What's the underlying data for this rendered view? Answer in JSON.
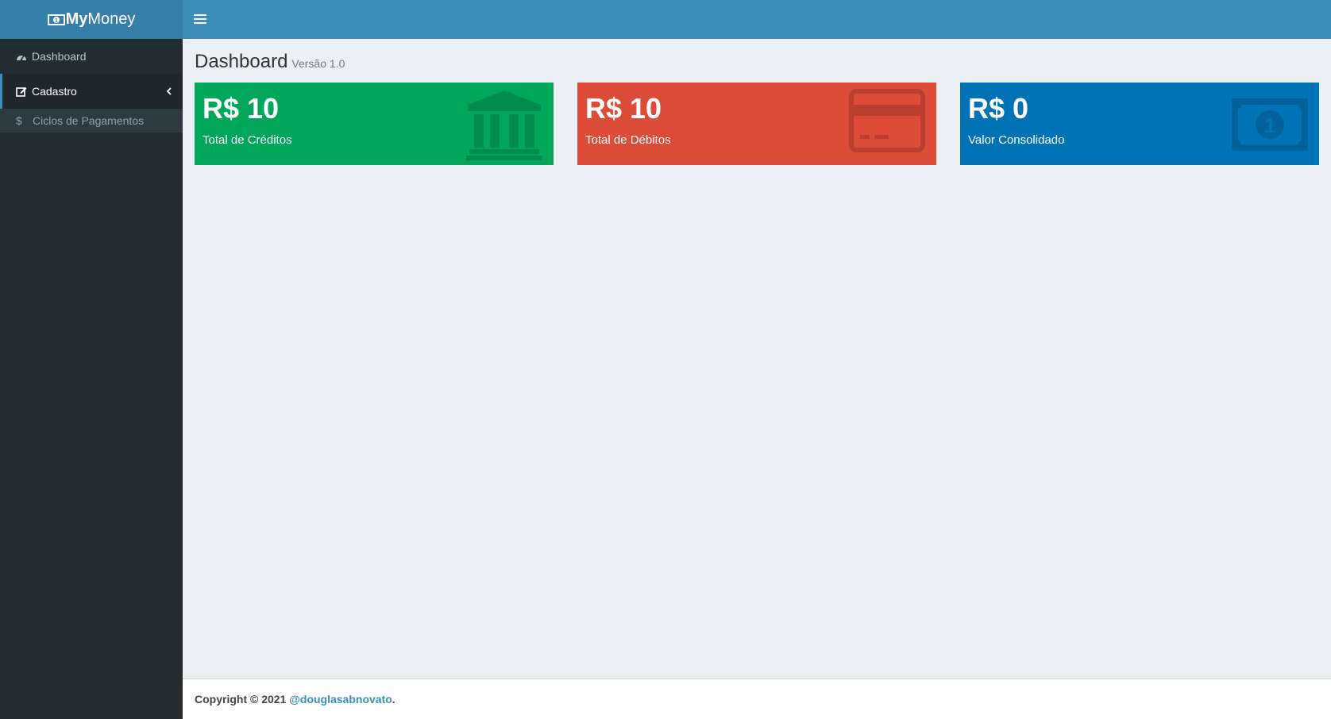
{
  "app": {
    "logo_bold": "My",
    "logo_text": " Money"
  },
  "sidebar": {
    "items": [
      {
        "label": "Dashboard",
        "icon": "dashboard-icon"
      },
      {
        "label": "Cadastro",
        "icon": "edit-icon"
      }
    ],
    "submenu": [
      {
        "label": "Ciclos de Pagamentos",
        "icon": "dollar-icon"
      }
    ]
  },
  "header": {
    "title": "Dashboard",
    "version": "Versão 1.0"
  },
  "boxes": [
    {
      "value": "R$ 10",
      "label": "Total de Créditos",
      "color": "#00a65a",
      "icon": "bank-icon"
    },
    {
      "value": "R$ 10",
      "label": "Total de Débitos",
      "color": "#dd4b39",
      "icon": "credit-card-icon"
    },
    {
      "value": "R$ 0",
      "label": "Valor Consolidado",
      "color": "#0073b7",
      "icon": "money-icon"
    }
  ],
  "footer": {
    "copyright": "Copyright © 2021 ",
    "link": "@douglasabnovato",
    "suffix": "."
  },
  "colors": {
    "sidebar_bg": "#222d32",
    "header_bg": "#3c8dbc",
    "logo_bg": "#367fa9"
  }
}
